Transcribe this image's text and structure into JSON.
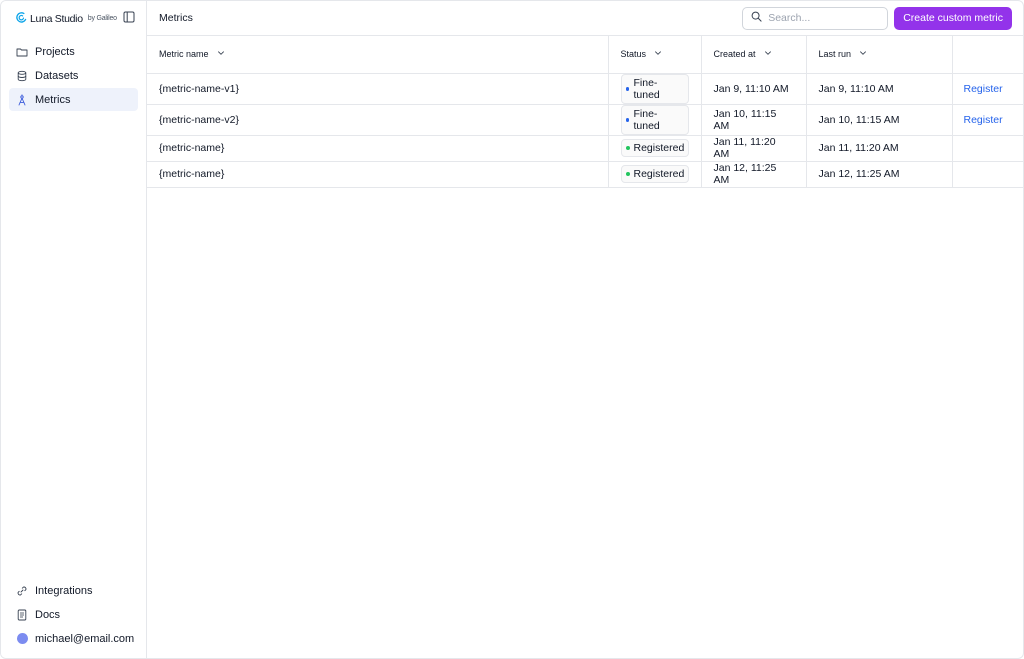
{
  "brand": {
    "name": "Luna Studio",
    "by": "by Galileo"
  },
  "sidebar": {
    "items": [
      {
        "label": "Projects",
        "icon": "folder-icon"
      },
      {
        "label": "Datasets",
        "icon": "database-icon"
      },
      {
        "label": "Metrics",
        "icon": "metric-icon",
        "active": true
      }
    ],
    "bottom": [
      {
        "label": "Integrations",
        "icon": "link-icon"
      },
      {
        "label": "Docs",
        "icon": "doc-icon"
      },
      {
        "label": "michael@email.com",
        "icon": "avatar"
      }
    ]
  },
  "header": {
    "title": "Metrics",
    "search_placeholder": "Search...",
    "create_label": "Create custom metric"
  },
  "table": {
    "columns": [
      "Metric name",
      "Status",
      "Created at",
      "Last run"
    ],
    "rows": [
      {
        "name": "{metric-name-v1}",
        "status": "Fine-tuned",
        "status_color": "#2563eb",
        "created": "Jan 9, 11:10 AM",
        "last_run": "Jan 9, 11:10 AM",
        "action": "Register"
      },
      {
        "name": "{metric-name-v2}",
        "status": "Fine-tuned",
        "status_color": "#2563eb",
        "created": "Jan 10, 11:15 AM",
        "last_run": "Jan 10, 11:15 AM",
        "action": "Register"
      },
      {
        "name": "{metric-name}",
        "status": "Registered",
        "status_color": "#22c55e",
        "created": "Jan 11, 11:20 AM",
        "last_run": "Jan 11, 11:20 AM",
        "action": ""
      },
      {
        "name": "{metric-name}",
        "status": "Registered",
        "status_color": "#22c55e",
        "created": "Jan 12, 11:25 AM",
        "last_run": "Jan 12, 11:25 AM",
        "action": ""
      }
    ]
  },
  "colors": {
    "accent": "#9333ea",
    "link": "#2563eb",
    "active_nav": "#eef2fb",
    "logo": "#0ea5e9"
  }
}
